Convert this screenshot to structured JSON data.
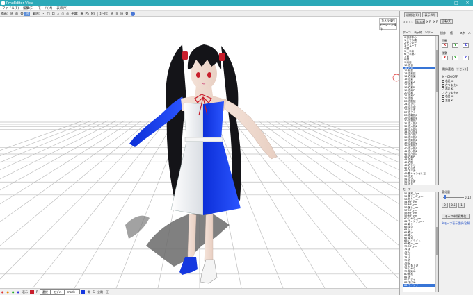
{
  "window": {
    "title": "PmxEditor View",
    "minimize": "—",
    "maximize": "□",
    "close": "✕"
  },
  "menu": [
    "ファイル(F)",
    "編集(E)",
    "モード(M)",
    "表示(V)"
  ],
  "toolbar": [
    "描画:",
    "頂",
    "面",
    "骨",
    "材",
    "|",
    "範囲:",
    "・",
    "□",
    "ロ",
    "△",
    "○",
    "◎",
    "子選:",
    "頂",
    "PS",
    "MS",
    "|",
    "ｽﾃｰﾀｽ:",
    "頂",
    "Tr",
    "頂",
    "骨"
  ],
  "viewport_buttons": [
    "カメラ操作",
    "モーション操作"
  ],
  "statusbar": {
    "mode_label": "表示",
    "rotate": "R",
    "sel1": "選択",
    "sel2": "モデル",
    "mode_select": "mode ▾",
    "extra": [
      "骨",
      "S",
      "全剛",
      "正"
    ]
  },
  "panel": {
    "tabs": [
      "初期化(C)",
      "表示(W)"
    ],
    "nav": [
      "<<",
      ">>",
      "Reset",
      "X-R",
      "X-R",
      "回転(P)"
    ],
    "bone_tabs": [
      "ボーン",
      "表示枠",
      "ツリー"
    ],
    "op_tabs": [
      "操作",
      "値",
      "スケール"
    ],
    "rotate_label": "回転",
    "move_label": "移動",
    "axes": [
      "X",
      "Y",
      "Z"
    ],
    "bone_filter_label": "剛体連結",
    "reset_label": "リセット",
    "ik_label": "IK - ON/OFF",
    "ik_items": [
      "右足IK",
      "左つま先IK",
      "右足IK",
      "左つま先IK",
      "右目IK",
      "左目IK"
    ],
    "bone_list": [
      "0:操作中心",
      "1:全ての親",
      "2:センター",
      "3:グルーブ",
      "4:腰",
      "5:上半身",
      "6:上半身2",
      "7:首",
      "8:頭",
      "9:両目",
      "10:左目",
      "11:右目",
      "12:前髪",
      "13:左前髪",
      "14:右前髪",
      "15:左髪",
      "16:左髪2",
      "17:右髪",
      "18:右髪2",
      "19:左肩P",
      "20:左肩",
      "21:左肩C",
      "22:左腕",
      "23:左腕捩",
      "24:左ひじ",
      "25:左手捩",
      "26:左手首",
      "27:左ダミー",
      "28:左親指0",
      "29:左親指1",
      "30:左親指2",
      "31:左人指1",
      "32:左人指2",
      "33:左人指3",
      "34:左中指1",
      "35:左中指2",
      "36:左中指3",
      "37:左薬指1",
      "38:左薬指2",
      "39:左薬指3",
      "40:左小指1",
      "41:左小指2",
      "42:左小指3",
      "43:右肩P",
      "44:右肩",
      "45:右腕",
      "46:右ひじ",
      "47:右手首",
      "48:下半身",
      "49:腰キャンセル左",
      "50:左足",
      "51:左ひざ",
      "52:左足首",
      "53:右足",
      "54:右ひざ",
      "55:右足首",
      "56:左足IK",
      "57:左つま先IK",
      "58:右足IK",
      "59:右つま先IK",
      "60:左つま先",
      "61:右つま先",
      "62:スカート1",
      "63:スカート2",
      "64:スカート3",
      "65:スカート4",
      "66:リボン",
      "67:リボン2",
      "68:髪飾り左",
      "69:髪飾り右"
    ],
    "bone_selected_index": 11,
    "morph_label": "モーフ",
    "morph_value_label": "変化量",
    "morph_value": "0.13",
    "morph_btns": [
      "0",
      "0.5",
      "1"
    ],
    "morph_apply": "モーフ(材)初期化",
    "morph_note": "※モーフ表示選択/全解",
    "morph_list": [
      "51:通常_Eye",
      "52:驚き_MF_ym",
      "53:怒り_ym",
      "54:MF_ym",
      "55:MF_ym",
      "56:困る_ym",
      "57:MF_ym",
      "58:MF_ym",
      "59:MF_ym",
      "60:にやり_ym",
      "61:ウィンク_ym",
      "62:瞬き",
      "63:笑い",
      "64:はぅ",
      "65:瞳小",
      "66:瞳大",
      "67:星目",
      "68:ハイライト",
      "69:瞳ー_ym",
      "70:MF_ym",
      "71:あ",
      "72:い",
      "73:う",
      "74:え",
      "75:お",
      "76:ω",
      "77:口角上げ",
      "78:にやり",
      "79:頬染め",
      "80:照れ",
      "81:涙",
      "82:口ぎゅ",
      "83:すぼめ",
      "84:ウインク"
    ]
  },
  "chart_colors": {
    "dress_blue": "#1538e0",
    "ribbon_red": "#c81e2c",
    "hair": "#141418",
    "panel_select": "#3875d6"
  }
}
